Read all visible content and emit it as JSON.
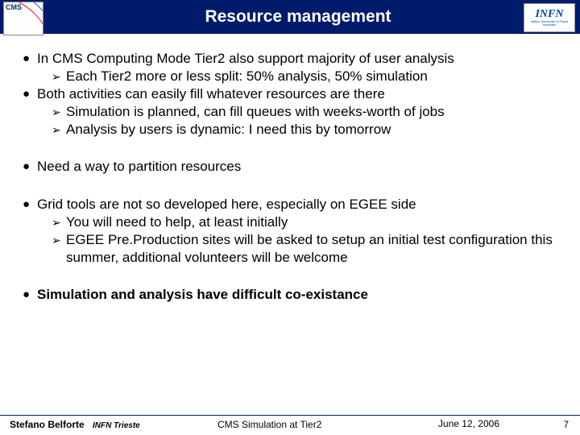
{
  "header": {
    "title": "Resource management",
    "logo_left_text": "CMS",
    "logo_right_text": "INFN",
    "logo_right_sub": "Istituto Nazionale di Fisica Nucleare"
  },
  "bullets": {
    "g1": {
      "b1": "In CMS Computing Mode Tier2 also  support majority of user analysis",
      "b1a": "Each Tier2 more or less split: 50% analysis, 50% simulation",
      "b2": "Both activities can easily fill whatever resources are there",
      "b2a": "Simulation is planned, can fill queues with  weeks-worth of jobs",
      "b2b": "Analysis by users is dynamic: I need this by tomorrow"
    },
    "g2": {
      "b1": "Need a way to partition resources"
    },
    "g3": {
      "b1": "Grid tools are not so developed here, especially on EGEE side",
      "b1a": "You will need to help, at least initially",
      "b1b": "EGEE Pre.Production sites will be asked to setup an initial test configuration this summer, additional volunteers will be welcome"
    },
    "g4": {
      "b1": "Simulation and analysis have difficult co-existance"
    }
  },
  "footer": {
    "author_name": "Stefano Belforte",
    "author_inst": "INFN Trieste",
    "center": "CMS Simulation at Tier2",
    "date": "June 12, 2006",
    "page": "7"
  }
}
